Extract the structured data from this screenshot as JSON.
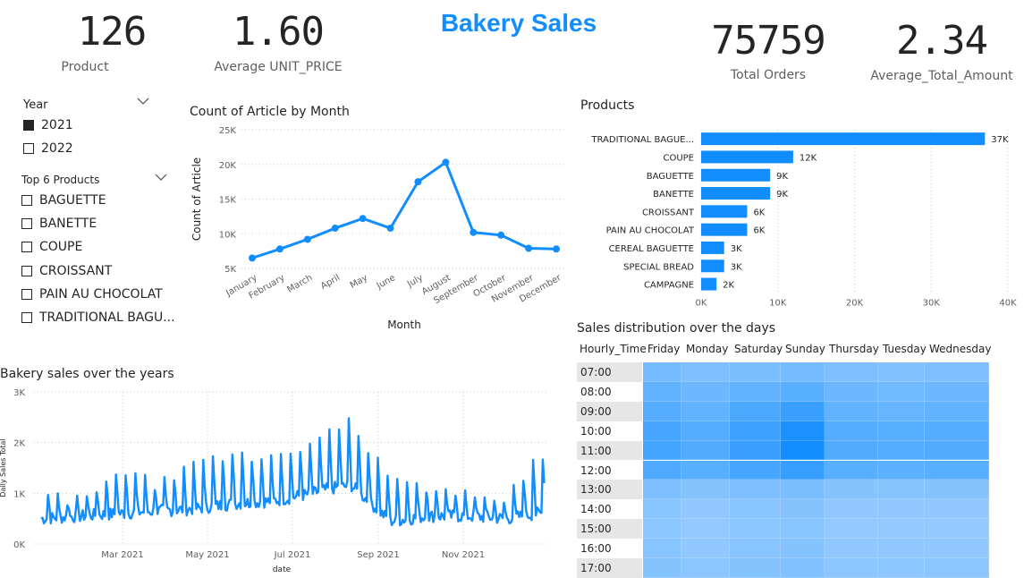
{
  "title": "Bakery Sales",
  "kpis": {
    "product": {
      "value": "126",
      "label": "Product"
    },
    "avg_price": {
      "value": "1.60",
      "label": "Average UNIT_PRICE"
    },
    "total_orders": {
      "value": "75759",
      "label": "Total Orders"
    },
    "avg_amount": {
      "value": "2.34",
      "label": "Average_Total_Amount"
    }
  },
  "slicers": {
    "year": {
      "label": "Year",
      "items": [
        {
          "label": "2021",
          "checked": true
        },
        {
          "label": "2022",
          "checked": false
        }
      ]
    },
    "products": {
      "label": "Top 6 Products",
      "items": [
        {
          "label": "BAGUETTE"
        },
        {
          "label": "BANETTE"
        },
        {
          "label": "COUPE"
        },
        {
          "label": "CROISSANT"
        },
        {
          "label": "PAIN AU CHOCOLAT"
        },
        {
          "label": "TRADITIONAL BAGU..."
        }
      ]
    }
  },
  "colors": {
    "accent": "#118dff",
    "text": "#252423",
    "muted": "#605e5c"
  },
  "chart_data": [
    {
      "type": "line",
      "title": "Count of Article by Month",
      "xlabel": "Month",
      "ylabel": "Count of Article",
      "categories": [
        "January",
        "February",
        "March",
        "April",
        "May",
        "June",
        "July",
        "August",
        "September",
        "October",
        "November",
        "December"
      ],
      "values": [
        6500,
        7800,
        9200,
        10800,
        12200,
        10800,
        17500,
        20300,
        10200,
        9800,
        7900,
        7800
      ],
      "ylim": [
        5000,
        25000
      ],
      "yticks": [
        "5K",
        "10K",
        "15K",
        "20K",
        "25K"
      ],
      "grid": true
    },
    {
      "type": "bar",
      "orientation": "horizontal",
      "title": "Products",
      "categories": [
        "TRADITIONAL BAGUE...",
        "COUPE",
        "BAGUETTE",
        "BANETTE",
        "CROISSANT",
        "PAIN AU CHOCOLAT",
        "CEREAL BAGUETTE",
        "SPECIAL BREAD",
        "CAMPAGNE"
      ],
      "values": [
        37000,
        12000,
        9000,
        9000,
        6000,
        6000,
        3000,
        3000,
        2000
      ],
      "labels": [
        "37K",
        "12K",
        "9K",
        "9K",
        "6K",
        "6K",
        "3K",
        "3K",
        "2K"
      ],
      "xlim": [
        0,
        40000
      ],
      "xticks": [
        "0K",
        "10K",
        "20K",
        "30K",
        "40K"
      ]
    },
    {
      "type": "line",
      "title": "Bakery sales over the years",
      "xlabel": "date",
      "ylabel": "Daily Sales Total",
      "ylim": [
        0,
        3000
      ],
      "yticks": [
        "0K",
        "1K",
        "2K",
        "3K"
      ],
      "xticks": [
        "Mar 2021",
        "May 2021",
        "Jul 2021",
        "Sep 2021",
        "Nov 2021"
      ],
      "grid": true,
      "weekly_pattern": true,
      "weekly_base": [
        {
          "week": 0,
          "low": 500,
          "peak": 1000
        },
        {
          "week": 4,
          "low": 550,
          "peak": 800
        },
        {
          "week": 8,
          "low": 600,
          "peak": 1500
        },
        {
          "week": 12,
          "low": 650,
          "peak": 1150
        },
        {
          "week": 16,
          "low": 700,
          "peak": 1500
        },
        {
          "week": 20,
          "low": 800,
          "peak": 1900
        },
        {
          "week": 24,
          "low": 850,
          "peak": 1600
        },
        {
          "week": 28,
          "low": 1000,
          "peak": 1950
        },
        {
          "week": 30,
          "low": 1100,
          "peak": 2200
        },
        {
          "week": 32,
          "low": 1150,
          "peak": 2450
        },
        {
          "week": 34,
          "low": 800,
          "peak": 1850
        },
        {
          "week": 36,
          "low": 450,
          "peak": 1300
        },
        {
          "week": 38,
          "low": 500,
          "peak": 1200
        },
        {
          "week": 40,
          "low": 550,
          "peak": 1150
        },
        {
          "week": 44,
          "low": 550,
          "peak": 900
        },
        {
          "week": 48,
          "low": 500,
          "peak": 800
        },
        {
          "week": 51,
          "low": 600,
          "peak": 1800
        }
      ]
    },
    {
      "type": "heatmap",
      "title": "Sales distribution over the days",
      "row_header": "Hourly_Time",
      "columns": [
        "Friday",
        "Monday",
        "Saturday",
        "Sunday",
        "Thursday",
        "Tuesday",
        "Wednesday"
      ],
      "rows": [
        "07:00",
        "08:00",
        "09:00",
        "10:00",
        "11:00",
        "12:00",
        "13:00",
        "14:00",
        "15:00",
        "16:00",
        "17:00"
      ],
      "values": [
        [
          0.45,
          0.4,
          0.42,
          0.45,
          0.4,
          0.38,
          0.4
        ],
        [
          0.55,
          0.5,
          0.55,
          0.6,
          0.5,
          0.48,
          0.5
        ],
        [
          0.62,
          0.55,
          0.68,
          0.78,
          0.55,
          0.52,
          0.55
        ],
        [
          0.7,
          0.62,
          0.76,
          0.95,
          0.62,
          0.6,
          0.62
        ],
        [
          0.72,
          0.64,
          0.78,
          1.0,
          0.64,
          0.62,
          0.64
        ],
        [
          0.66,
          0.6,
          0.7,
          0.8,
          0.6,
          0.58,
          0.6
        ],
        [
          0.4,
          0.36,
          0.4,
          0.42,
          0.36,
          0.35,
          0.36
        ],
        [
          0.34,
          0.3,
          0.34,
          0.36,
          0.3,
          0.3,
          0.3
        ],
        [
          0.32,
          0.28,
          0.32,
          0.34,
          0.28,
          0.28,
          0.28
        ],
        [
          0.34,
          0.3,
          0.34,
          0.36,
          0.3,
          0.3,
          0.3
        ],
        [
          0.36,
          0.32,
          0.36,
          0.38,
          0.32,
          0.31,
          0.32
        ]
      ]
    }
  ]
}
